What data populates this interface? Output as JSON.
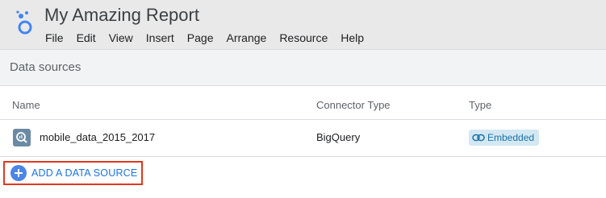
{
  "app": {
    "title": "My Amazing Report",
    "logo_icon": "looker-studio-logo-icon"
  },
  "menu": [
    "File",
    "Edit",
    "View",
    "Insert",
    "Page",
    "Arrange",
    "Resource",
    "Help"
  ],
  "panel": {
    "title": "Data sources"
  },
  "table": {
    "columns": [
      "Name",
      "Connector Type",
      "Type"
    ],
    "rows": [
      {
        "icon": "bigquery-icon",
        "name": "mobile_data_2015_2017",
        "connector": "BigQuery",
        "type": "Embedded",
        "type_icon": "link-icon"
      }
    ]
  },
  "actions": {
    "add_data_source_label": "ADD A DATA SOURCE",
    "add_icon": "plus-circle-icon"
  },
  "colors": {
    "header_bg": "#e9e9e9",
    "accent_blue": "#1a73e8",
    "highlight_border": "#e1381f",
    "badge_bg": "#d3e8f3"
  }
}
